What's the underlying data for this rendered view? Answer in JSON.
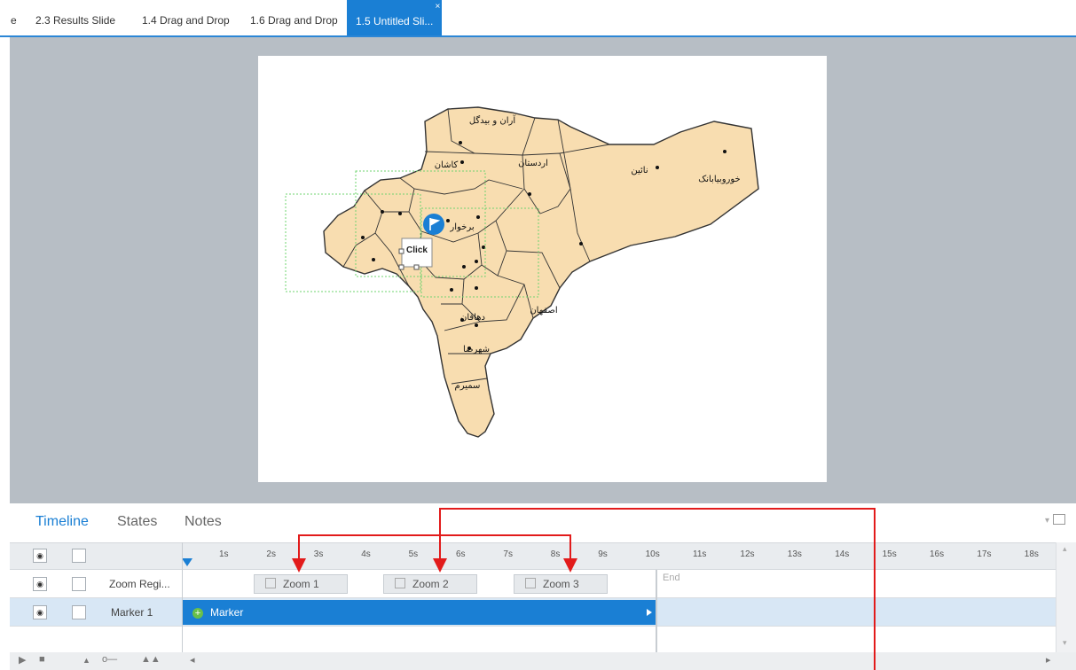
{
  "tabs": [
    {
      "label": "e",
      "active": false
    },
    {
      "label": "2.3 Results Slide",
      "active": false
    },
    {
      "label": "1.4 Drag and Drop",
      "active": false
    },
    {
      "label": "1.6 Drag and Drop",
      "active": false
    },
    {
      "label": "1.5 Untitled Sli...",
      "active": true,
      "close": "×"
    }
  ],
  "slide": {
    "hotspot_label": "Click",
    "regions": [
      {
        "name": "آران و بیدگل"
      },
      {
        "name": "کاشان"
      },
      {
        "name": "اردستان"
      },
      {
        "name": "نائین"
      },
      {
        "name": "خوروبیابانک"
      },
      {
        "name": "برخوار"
      },
      {
        "name": "اصفهان"
      },
      {
        "name": "دهاقان"
      },
      {
        "name": "شهرضا"
      },
      {
        "name": "سمیرم"
      }
    ]
  },
  "timeline": {
    "tabs": [
      {
        "label": "Timeline",
        "active": true
      },
      {
        "label": "States",
        "active": false
      },
      {
        "label": "Notes",
        "active": false
      }
    ],
    "ruler_ticks": [
      "1s",
      "2s",
      "3s",
      "4s",
      "5s",
      "6s",
      "7s",
      "8s",
      "9s",
      "10s",
      "11s",
      "12s",
      "13s",
      "14s",
      "15s",
      "16s",
      "17s",
      "18s"
    ],
    "rows": [
      {
        "label": "Zoom Regi...",
        "selected": false,
        "eye": "◉"
      },
      {
        "label": "Marker 1",
        "selected": true,
        "eye": "◉"
      }
    ],
    "zoom_blocks": [
      {
        "label": "Zoom 1"
      },
      {
        "label": "Zoom 2"
      },
      {
        "label": "Zoom 3"
      }
    ],
    "marker_label": "Marker",
    "marker_plus": "+",
    "end_label": "End",
    "controls": {
      "play": "▶",
      "stop": "■",
      "zoom_out": "▲",
      "slider": "o—",
      "zoom_in": "▲▲",
      "scroll_left": "◂",
      "scroll_up": "▴",
      "scroll_down": "▾",
      "scroll_right": "▸"
    }
  },
  "colors": {
    "accent": "#1a7fd4",
    "stage": "#b7bec5",
    "map_fill": "#f8ddb0",
    "annotation": "#e21b1b"
  }
}
